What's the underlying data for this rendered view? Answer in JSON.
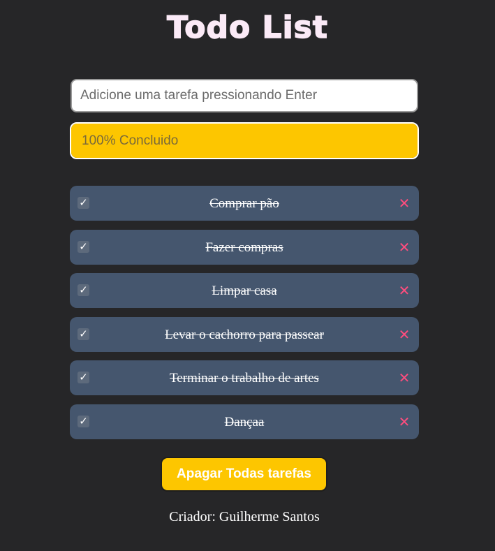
{
  "app": {
    "title": "Todo List"
  },
  "input": {
    "placeholder": "Adicione uma tarefa pressionando Enter",
    "value": ""
  },
  "progress": {
    "label": "100% Concluido",
    "percent": 100,
    "fill_color": "#fdc600"
  },
  "tasks": [
    {
      "label": "Comprar pão",
      "completed": true
    },
    {
      "label": "Fazer compras",
      "completed": true
    },
    {
      "label": "Limpar casa",
      "completed": true
    },
    {
      "label": "Levar o cachorro para passear",
      "completed": true
    },
    {
      "label": "Terminar o trabalho de artes",
      "completed": true
    },
    {
      "label": "Dançaa",
      "completed": true
    }
  ],
  "icons": {
    "check": "checkmark-icon",
    "delete": "close-icon"
  },
  "clear_button": {
    "label": "Apagar Todas tarefas"
  },
  "footer": {
    "text": "Criador: Guilherme Santos"
  },
  "colors": {
    "background": "#262628",
    "accent": "#fdc600",
    "task_bg": "#45566e",
    "delete": "#ff4d7e"
  }
}
